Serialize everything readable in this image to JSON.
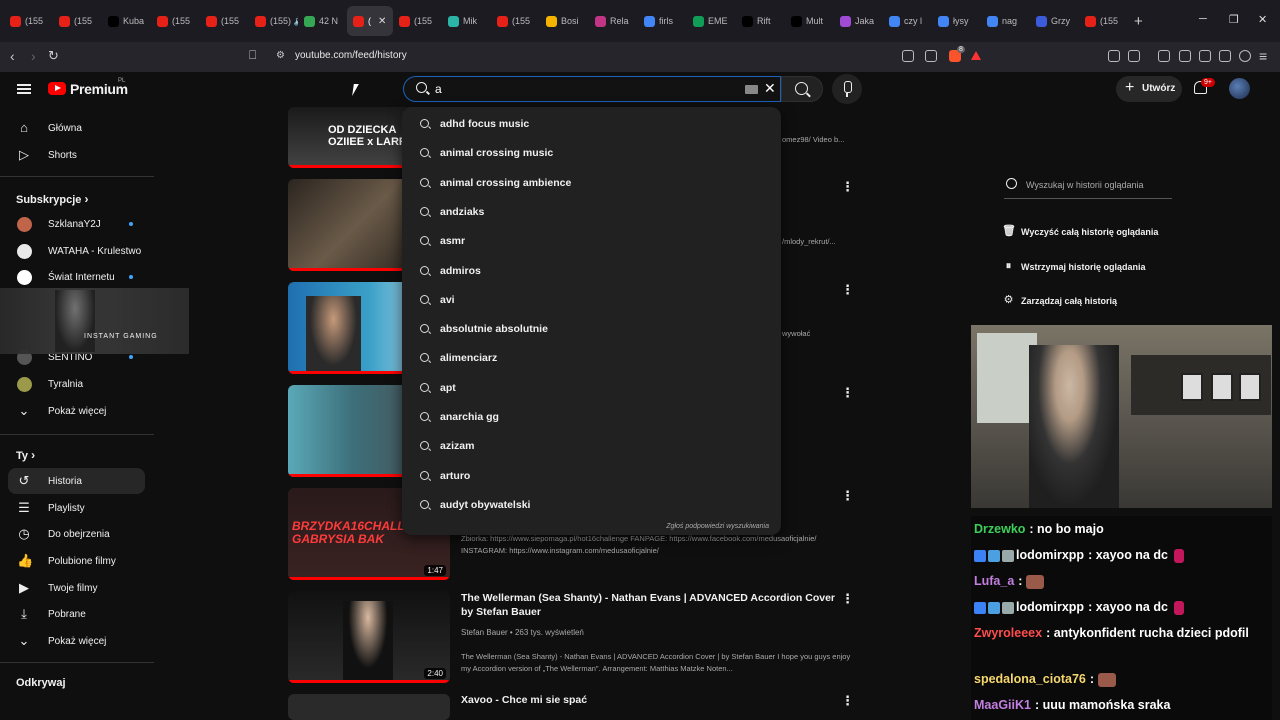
{
  "browser": {
    "tabs": [
      {
        "label": "(155",
        "color": "#e62117"
      },
      {
        "label": "(155",
        "color": "#e62117"
      },
      {
        "label": "Kuba",
        "color": "#000000"
      },
      {
        "label": "(155",
        "color": "#e62117"
      },
      {
        "label": "(155",
        "color": "#e62117"
      },
      {
        "label": "(155) 🔊 (",
        "color": "#e62117"
      },
      {
        "label": "42 N",
        "color": "#34a853"
      },
      {
        "label": "(",
        "color": "#e62117",
        "active": true
      },
      {
        "label": "(155",
        "color": "#e62117"
      },
      {
        "label": "Mik",
        "color": "#2bb5a6"
      },
      {
        "label": "(155",
        "color": "#e62117"
      },
      {
        "label": "Bosi",
        "color": "#f4b400"
      },
      {
        "label": "Rela",
        "color": "#c13584"
      },
      {
        "label": "firls",
        "color": "#4285f4"
      },
      {
        "label": "EME",
        "color": "#0f9d58"
      },
      {
        "label": "Rift",
        "color": "#000000"
      },
      {
        "label": "Mult",
        "color": "#000000"
      },
      {
        "label": "Jaka",
        "color": "#a04bd6"
      },
      {
        "label": "czy l",
        "color": "#4285f4"
      },
      {
        "label": "łysy",
        "color": "#4285f4"
      },
      {
        "label": "nag",
        "color": "#4285f4"
      },
      {
        "label": "Grzy",
        "color": "#3b5bdb"
      },
      {
        "label": "(155",
        "color": "#e62117"
      }
    ],
    "url": "youtube.com/feed/history",
    "brave_badge": "8"
  },
  "youtube": {
    "logo_text": "Premium",
    "logo_region": "PL",
    "search_value": "a",
    "create_label": "Utwórz",
    "notifications_badge": "9+"
  },
  "sidebar": {
    "main": [
      {
        "label": "Główna",
        "icon": "home-icon"
      },
      {
        "label": "Shorts",
        "icon": "shorts-icon"
      }
    ],
    "subs_header": "Subskrypcje",
    "subs": [
      {
        "label": "SzklanaY2J",
        "color": "#c0654a",
        "dot": true
      },
      {
        "label": "WATAHA - Krulestwo",
        "color": "#e9e9e9",
        "dot": false
      },
      {
        "label": "Świat Internetu",
        "color": "#ffffff",
        "dot": true
      },
      {
        "label": "SENTINO",
        "color": "#555555",
        "dot": true
      },
      {
        "label": "Tyralnia",
        "color": "#9a9a4a",
        "dot": false
      }
    ],
    "subs_more": "Pokaż więcej",
    "overlay_text": "INSTANT GAMING",
    "you_header": "Ty",
    "you": [
      {
        "label": "Historia",
        "icon": "history-icon",
        "selected": true
      },
      {
        "label": "Playlisty",
        "icon": "playlist-icon"
      },
      {
        "label": "Do obejrzenia",
        "icon": "clock-icon"
      },
      {
        "label": "Polubione filmy",
        "icon": "like-icon"
      },
      {
        "label": "Twoje filmy",
        "icon": "video-icon"
      },
      {
        "label": "Pobrane",
        "icon": "download-icon"
      }
    ],
    "you_more": "Pokaż więcej",
    "explore_header": "Odkrywaj"
  },
  "suggestions": [
    "adhd focus music",
    "animal crossing music",
    "animal crossing ambience",
    "andziaks",
    "asmr",
    "admiros",
    "avi",
    "absolutnie absolutnie",
    "alimenciarz",
    "apt",
    "anarchia gg",
    "azizam",
    "arturo",
    "audyt obywatelski"
  ],
  "suggestions_report": "Zgłoś podpowiedzi wyszukiwania",
  "videos": {
    "v1": {
      "overlay": "OD DZIECKA\nOZIIEE x LARRY",
      "desc": "omez98/ Video b..."
    },
    "v2": {
      "desc": "/mlody_rekrut/..."
    },
    "v3": {
      "desc": "wywołać"
    },
    "v5": {
      "overlay": "BRZYDKA16CHALLENGE2 GABRYSIA BAK",
      "duration": "1:47",
      "desc": "Zbiorka: https://www.siepomaga.pl/hot16challenge FANPAGE: https://www.facebook.com/medusaoficjalnie/ INSTAGRAM: https://www.instagram.com/medusaoficjalnie/"
    },
    "v6": {
      "title": "The Wellerman (Sea Shanty) - Nathan Evans | ADVANCED Accordion Cover by Stefan Bauer",
      "meta": "Stefan Bauer • 263 tys. wyświetleń",
      "duration": "2:40",
      "desc": "The Wellerman (Sea Shanty) - Nathan Evans | ADVANCED Accordion Cover | by Stefan Bauer I hope you guys enjoy my Accordion version of „The Wellerman\". Arrangement: Matthias Matzke Noten..."
    },
    "v7": {
      "title": "Xavoo - Chce mi sie spać"
    }
  },
  "right_panel": {
    "search_placeholder": "Wyszukaj w historii oglądania",
    "actions": [
      {
        "label": "Wyczyść całą historię oglądania",
        "icon": "trash-icon"
      },
      {
        "label": "Wstrzymaj historię oglądania",
        "icon": "pause-icon"
      },
      {
        "label": "Zarządzaj całą historią",
        "icon": "gear-icon"
      }
    ]
  },
  "chat": [
    {
      "name": "Drzewko",
      "text": ": no bo majo",
      "color": "#3ecf5a"
    },
    {
      "name": "lodomirxpp",
      "text": ": xayoo na dc",
      "color": "#ffffff"
    },
    {
      "name": "Lufa_a",
      "text": ":",
      "color": "#c27fe0"
    },
    {
      "name": "lodomirxpp",
      "text": ": xayoo na dc",
      "color": "#ffffff"
    },
    {
      "name": "Zwyroleeex",
      "text": ": antykonfident rucha dzieci pdofil",
      "color": "#ff4d4d"
    },
    {
      "name": "spedalona_ciota76",
      "text": ":",
      "color": "#f5d76e"
    },
    {
      "name": "MaaGiiK1",
      "text": ": uuu mamońska sraka",
      "color": "#c27fe0"
    }
  ]
}
